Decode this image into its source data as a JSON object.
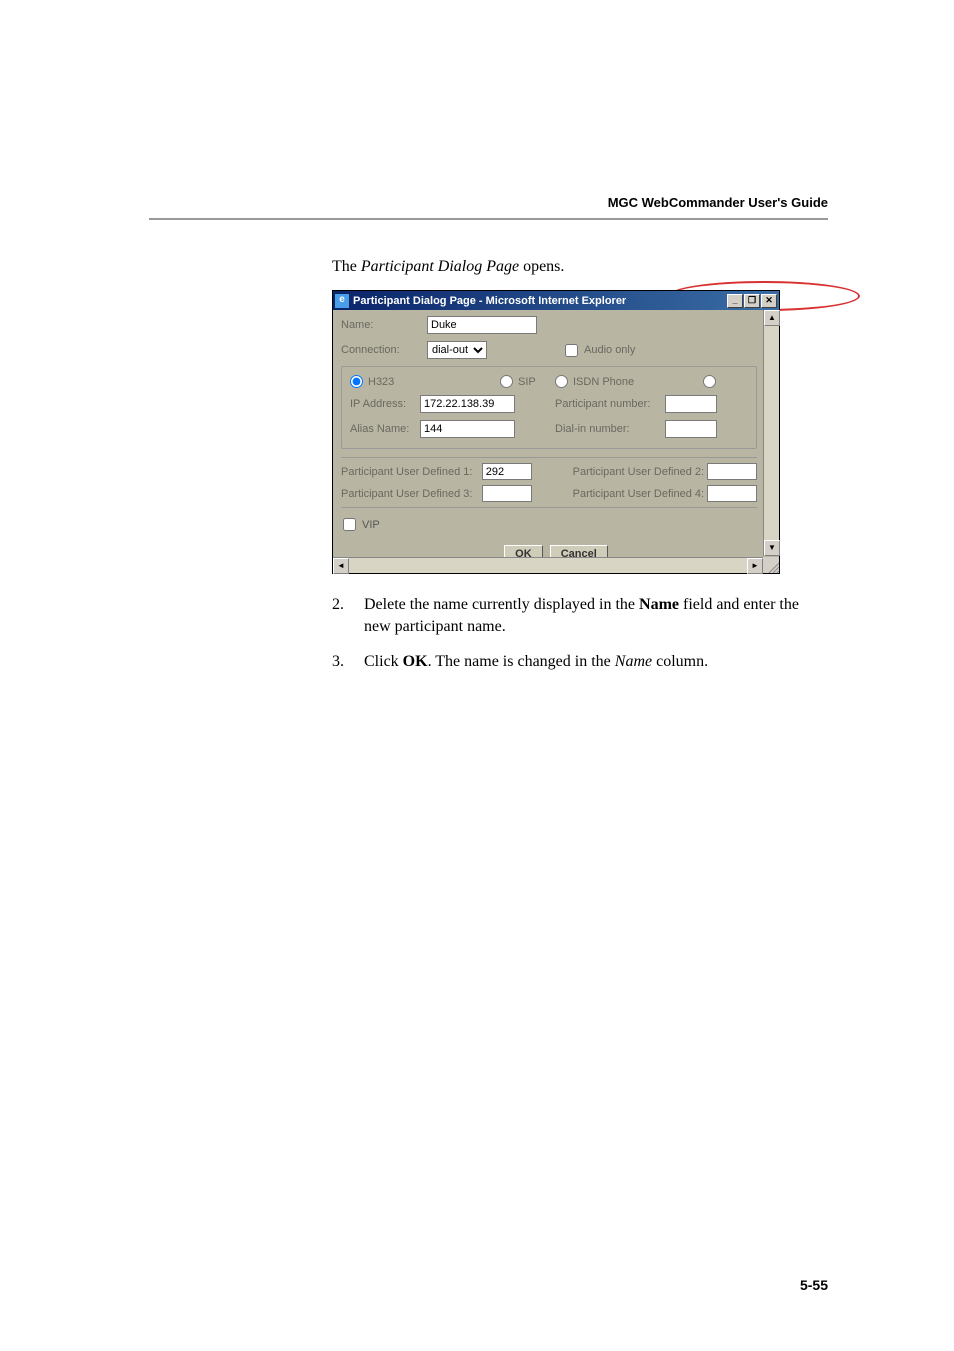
{
  "header": {
    "guide_title": "MGC WebCommander User's Guide"
  },
  "intro": {
    "prefix": "The ",
    "italic": "Participant Dialog Page",
    "suffix": " opens."
  },
  "dialog": {
    "window_title": "Participant Dialog Page - Microsoft Internet Explorer",
    "minimize": "_",
    "restore": "❐",
    "close": "✕",
    "name_label": "Name:",
    "name_value": "Duke",
    "connection_label": "Connection:",
    "connection_value": "dial-out",
    "audio_only_label": "Audio only",
    "h323_label": "H323",
    "sip_label": "SIP",
    "isdn_label": "ISDN Phone",
    "ip_address_label": "IP Address:",
    "ip_address_value": "172.22.138.39",
    "participant_number_label": "Participant number:",
    "participant_number_value": "",
    "alias_label": "Alias Name:",
    "alias_value": "144",
    "dialin_label": "Dial-in number:",
    "dialin_value": "",
    "udef1_label": "Participant User Defined 1:",
    "udef1_value": "292",
    "udef2_label": "Participant User Defined 2:",
    "udef2_value": "",
    "udef3_label": "Participant User Defined 3:",
    "udef3_value": "",
    "udef4_label": "Participant User Defined 4:",
    "udef4_value": "",
    "vip_label": "VIP",
    "ok_btn": "OK",
    "cancel_btn": "Cancel"
  },
  "steps": {
    "s2_num": "2.",
    "s2_a": "Delete the name currently displayed in the ",
    "s2_bold": "Name",
    "s2_b": " field and enter the new participant name.",
    "s3_num": "3.",
    "s3_a": "Click ",
    "s3_bold": "OK",
    "s3_b": ". The name is changed in the ",
    "s3_italic": "Name",
    "s3_c": " column."
  },
  "footer": {
    "page": "5-55"
  }
}
